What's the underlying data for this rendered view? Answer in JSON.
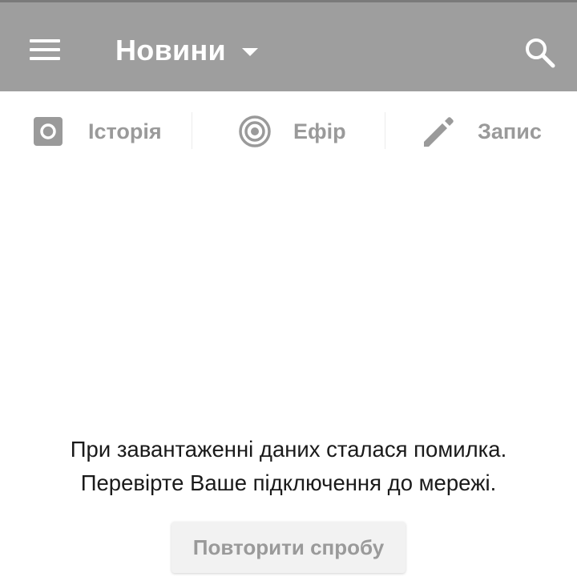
{
  "app_bar": {
    "menu_icon": "hamburger-menu-icon",
    "title": "Новини",
    "dropdown_icon": "caret-down-icon",
    "search_icon": "search-icon",
    "color": "#9e9e9e"
  },
  "tabs": [
    {
      "label": "Історія",
      "icon": "story-camera-icon"
    },
    {
      "label": "Ефір",
      "icon": "live-broadcast-icon"
    },
    {
      "label": "Запис",
      "icon": "pencil-icon"
    }
  ],
  "error": {
    "line1": "При завантаженні даних сталася помилка.",
    "line2": "Перевірте Ваше підключення до мережі."
  },
  "retry_button": {
    "label": "Повторити спробу"
  }
}
